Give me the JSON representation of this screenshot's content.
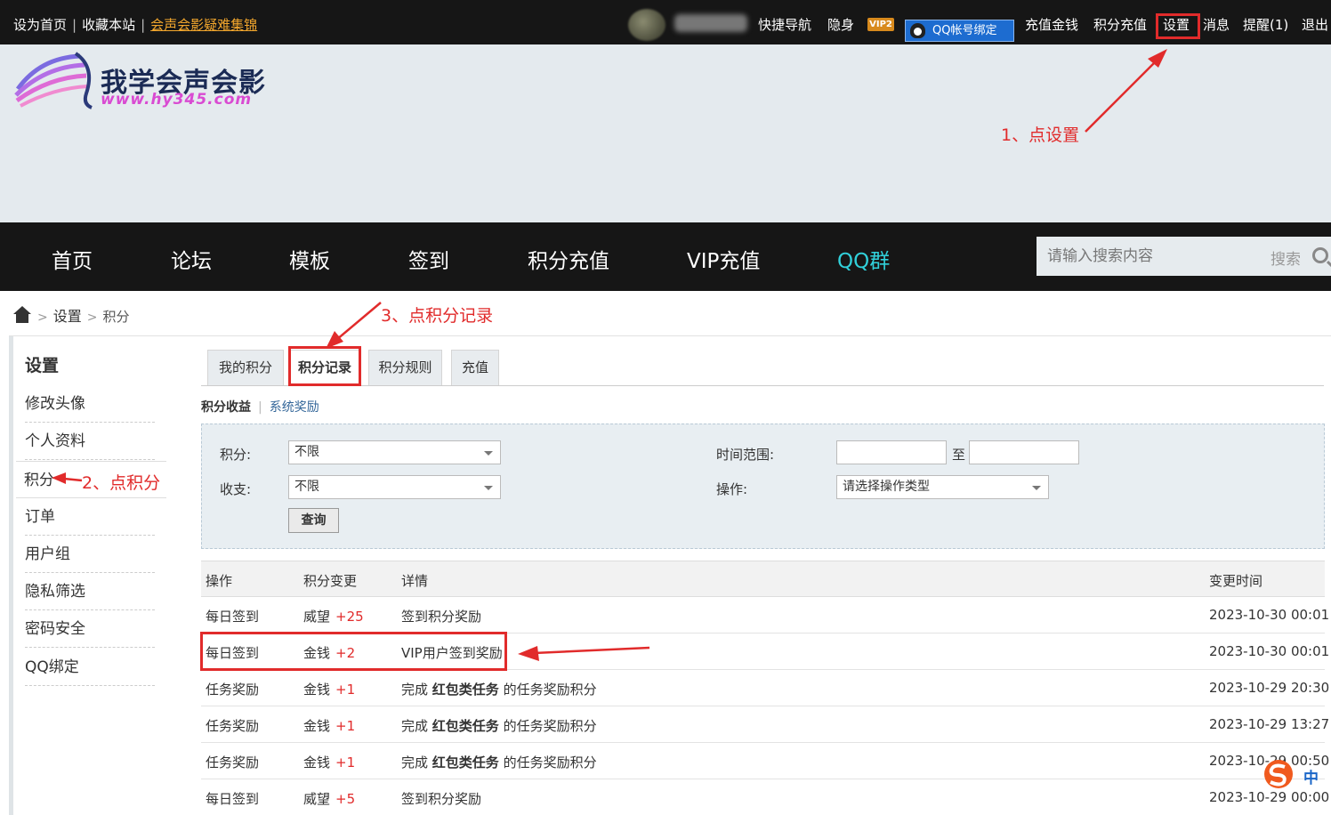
{
  "topbar": {
    "links": [
      "设为首页",
      "收藏本站"
    ],
    "highlight_link": "会声会影疑难集锦",
    "nav": [
      "快捷导航",
      "隐身"
    ],
    "vip_badge": "VIP2",
    "qq_bind": "QQ帐号绑定",
    "right_nav": [
      "充值金钱",
      "积分充值",
      "设置",
      "消息",
      "提醒(1)",
      "退出"
    ]
  },
  "banner": {
    "logo_text": "我学会声会影",
    "logo_url": "www.hy345.com",
    "annotation_1": "1、点设置"
  },
  "main_nav": {
    "items": [
      "首页",
      "论坛",
      "模板",
      "签到",
      "积分充值",
      "VIP充值",
      "QQ群"
    ],
    "search_placeholder": "请输入搜索内容",
    "search_button": "搜索"
  },
  "breadcrumb": {
    "level1": "设置",
    "level2": "积分"
  },
  "annotation_3": "3、点积分记录",
  "annotation_2": "2、点积分",
  "sidebar": {
    "title": "设置",
    "items": [
      "修改头像",
      "个人资料",
      "积分",
      "订单",
      "用户组",
      "隐私筛选",
      "密码安全",
      "QQ绑定"
    ]
  },
  "tabs": [
    "我的积分",
    "积分记录",
    "积分规则",
    "充值"
  ],
  "subtabs": {
    "active": "积分收益",
    "other": "系统奖励"
  },
  "filter": {
    "points_label": "积分:",
    "points_value": "不限",
    "inout_label": "收支:",
    "inout_value": "不限",
    "time_label": "时间范围:",
    "to": "至",
    "op_label": "操作:",
    "op_value": "请选择操作类型",
    "query_button": "查询"
  },
  "table": {
    "headers": [
      "操作",
      "积分变更",
      "详情",
      "变更时间"
    ],
    "rows": [
      {
        "op": "每日签到",
        "type": "威望",
        "delta": "+25",
        "detail_pre": "签到积分奖励",
        "detail_bold": "",
        "detail_post": "",
        "time": "2023-10-30 00:01"
      },
      {
        "op": "每日签到",
        "type": "金钱",
        "delta": "+2",
        "detail_pre": "VIP用户签到奖励",
        "detail_bold": "",
        "detail_post": "",
        "time": "2023-10-30 00:01"
      },
      {
        "op": "任务奖励",
        "type": "金钱",
        "delta": "+1",
        "detail_pre": "完成 ",
        "detail_bold": "红包类任务",
        "detail_post": " 的任务奖励积分",
        "time": "2023-10-29 20:30"
      },
      {
        "op": "任务奖励",
        "type": "金钱",
        "delta": "+1",
        "detail_pre": "完成 ",
        "detail_bold": "红包类任务",
        "detail_post": " 的任务奖励积分",
        "time": "2023-10-29 13:27"
      },
      {
        "op": "任务奖励",
        "type": "金钱",
        "delta": "+1",
        "detail_pre": "完成 ",
        "detail_bold": "红包类任务",
        "detail_post": " 的任务奖励积分",
        "time": "2023-10-29 00:50"
      },
      {
        "op": "每日签到",
        "type": "威望",
        "delta": "+5",
        "detail_pre": "签到积分奖励",
        "detail_bold": "",
        "detail_post": "",
        "time": "2023-10-29 00:00"
      }
    ]
  },
  "ime": {
    "label": "中"
  },
  "colors": {
    "annotation": "#e12b2b",
    "topbar": "#161616",
    "qq_accent": "#31d0da"
  }
}
